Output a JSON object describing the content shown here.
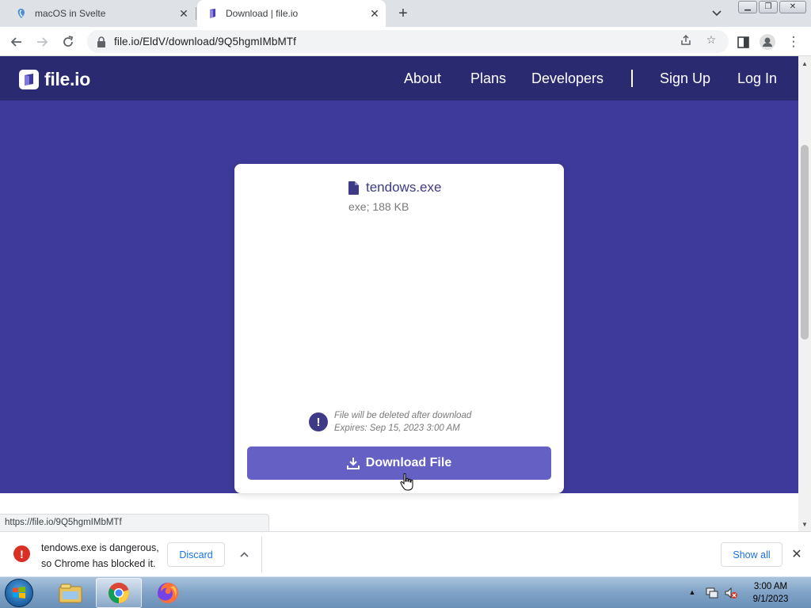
{
  "browser": {
    "tabs": [
      {
        "title": "macOS in Svelte",
        "active": false
      },
      {
        "title": "Download | file.io",
        "active": true
      }
    ],
    "url": "file.io/EldV/download/9Q5hgmIMbMTf",
    "status_url": "https://file.io/9Q5hgmIMbMTf"
  },
  "site": {
    "logo_text": "file.io",
    "nav": {
      "about": "About",
      "plans": "Plans",
      "developers": "Developers",
      "sign_up": "Sign Up",
      "log_in": "Log In"
    },
    "colors": {
      "nav_bg": "#2a2a70",
      "hero_bg": "#3e3a9b",
      "button_bg": "#6560c4",
      "accent": "#3e3a86"
    }
  },
  "file": {
    "name": "tendows.exe",
    "meta": "exe; 188 KB",
    "notice_line1": "File will be deleted after download",
    "notice_line2": "Expires: Sep 15, 2023 3:00 AM",
    "download_label": "Download File"
  },
  "download_shelf": {
    "warning_line1": "tendows.exe is dangerous,",
    "warning_line2": "so Chrome has blocked it.",
    "discard_label": "Discard",
    "show_all_label": "Show all"
  },
  "taskbar": {
    "time": "3:00 AM",
    "date": "9/1/2023",
    "pinned": [
      "explorer-icon",
      "chrome-icon",
      "firefox-icon"
    ]
  }
}
